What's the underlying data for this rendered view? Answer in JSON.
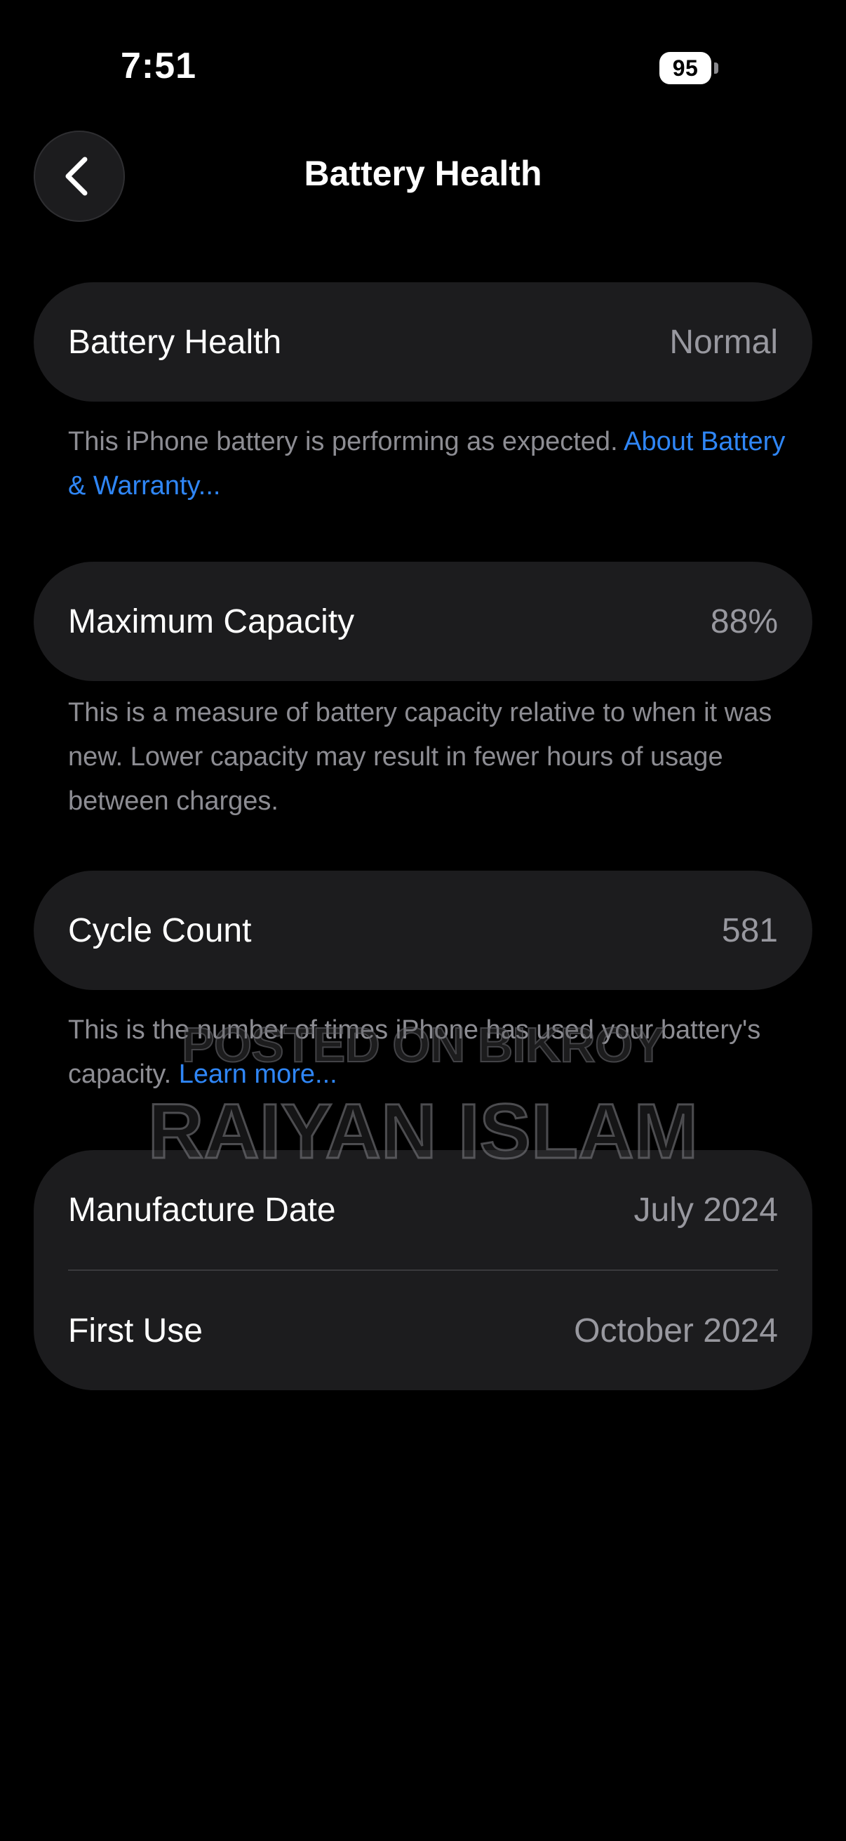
{
  "status_bar": {
    "time": "7:51",
    "battery_level": "95"
  },
  "nav": {
    "title": "Battery Health",
    "back_icon": "chevron-left-icon"
  },
  "sections": {
    "health": {
      "label": "Battery Health",
      "value": "Normal",
      "footnote_text": "This iPhone battery is performing as expected. ",
      "footnote_link": "About Battery & Warranty..."
    },
    "capacity": {
      "label": "Maximum Capacity",
      "value": "88%",
      "footnote_text": "This is a measure of battery capacity relative to when it was new. Lower capacity may result in fewer hours of usage between charges."
    },
    "cycles": {
      "label": "Cycle Count",
      "value": "581",
      "footnote_text": "This is the number of times iPhone has used your battery's capacity. ",
      "footnote_link": "Learn more..."
    },
    "dates": {
      "manufacture_label": "Manufacture Date",
      "manufacture_value": "July 2024",
      "first_use_label": "First Use",
      "first_use_value": "October 2024"
    }
  },
  "watermark": {
    "line1": "POSTED ON BIKROY",
    "line2": "RAIYAN ISLAM"
  },
  "colors": {
    "background": "#000000",
    "card": "#1c1c1e",
    "secondary_text": "#98989f",
    "footnote_text": "#8d8d93",
    "link": "#2f86f6"
  }
}
